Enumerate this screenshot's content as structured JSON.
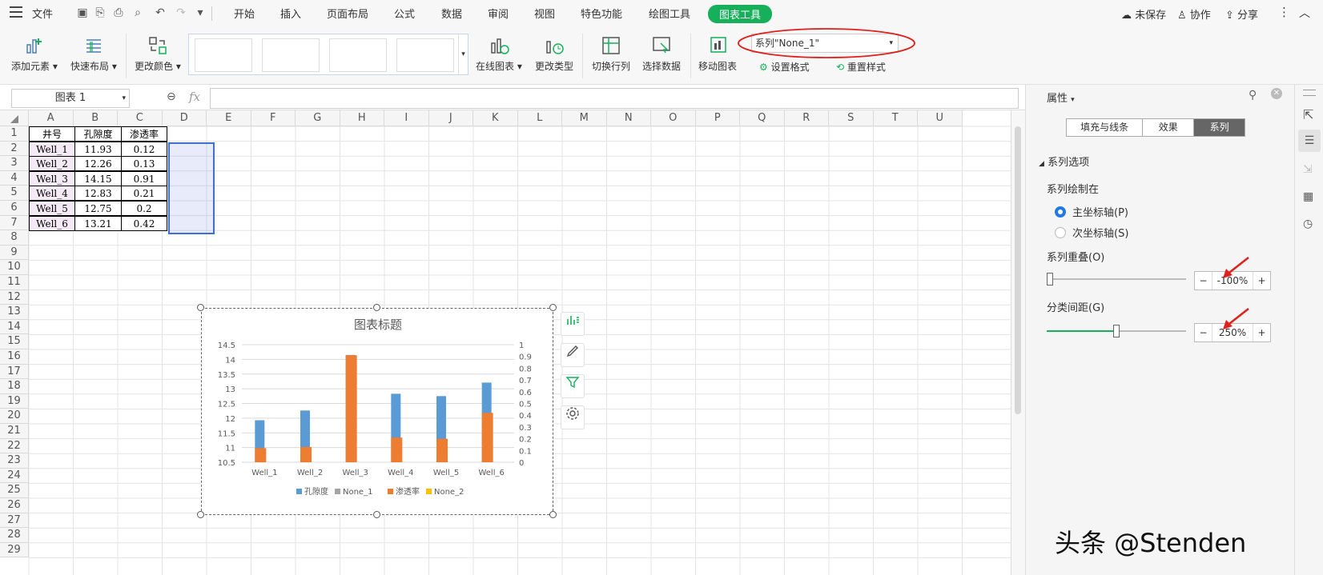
{
  "menubar": {
    "file": "文件",
    "tabs": [
      "开始",
      "插入",
      "页面布局",
      "公式",
      "数据",
      "审阅",
      "视图",
      "特色功能",
      "绘图工具",
      "图表工具"
    ],
    "right": {
      "unsaved": "未保存",
      "collab": "协作",
      "share": "分享"
    }
  },
  "ribbon": {
    "add_element": "添加元素",
    "quick_layout": "快速布局",
    "change_color": "更改颜色",
    "online_chart": "在线图表",
    "change_type": "更改类型",
    "switch_row_col": "切换行列",
    "select_data": "选择数据",
    "move_chart": "移动图表",
    "series_select": "系列\"None_1\"",
    "set_format": "设置格式",
    "reset_style": "重置样式"
  },
  "formula": {
    "name_box": "图表 1",
    "fx": "fx",
    "value": ""
  },
  "columns": [
    "A",
    "B",
    "C",
    "D",
    "E",
    "F",
    "G",
    "H",
    "I",
    "J",
    "K",
    "L",
    "M",
    "N",
    "O",
    "P",
    "Q",
    "R",
    "S",
    "T",
    "U"
  ],
  "rows": [
    "1",
    "2",
    "3",
    "4",
    "5",
    "6",
    "7",
    "8",
    "9",
    "10",
    "11",
    "12",
    "13",
    "14",
    "15",
    "16",
    "17",
    "18",
    "19",
    "20",
    "21",
    "22",
    "23",
    "24",
    "25",
    "26",
    "27",
    "28",
    "29"
  ],
  "table": {
    "headers": [
      "井号",
      "孔隙度",
      "渗透率"
    ],
    "rows": [
      [
        "Well_1",
        "11.93",
        "0.12"
      ],
      [
        "Well_2",
        "12.26",
        "0.13"
      ],
      [
        "Well_3",
        "14.15",
        "0.91"
      ],
      [
        "Well_4",
        "12.83",
        "0.21"
      ],
      [
        "Well_5",
        "12.75",
        "0.2"
      ],
      [
        "Well_6",
        "13.21",
        "0.42"
      ]
    ]
  },
  "chart_data": {
    "type": "bar",
    "title": "图表标题",
    "categories": [
      "Well_1",
      "Well_2",
      "Well_3",
      "Well_4",
      "Well_5",
      "Well_6"
    ],
    "series": [
      {
        "name": "孔隙度",
        "axis": "primary",
        "values": [
          11.93,
          12.26,
          14.15,
          12.83,
          12.75,
          13.21
        ],
        "color": "#5b9bd5"
      },
      {
        "name": "None_1",
        "axis": "primary",
        "values": [],
        "color": "#a5a5a5"
      },
      {
        "name": "渗透率",
        "axis": "secondary",
        "values": [
          0.12,
          0.13,
          0.91,
          0.21,
          0.2,
          0.42
        ],
        "color": "#ed7d31"
      },
      {
        "name": "None_2",
        "axis": "secondary",
        "values": [],
        "color": "#ffc000"
      }
    ],
    "y_ticks": [
      "14.5",
      "14",
      "13.5",
      "13",
      "12.5",
      "12",
      "11.5",
      "11",
      "10.5"
    ],
    "y2_ticks": [
      "1",
      "0.9",
      "0.8",
      "0.7",
      "0.6",
      "0.5",
      "0.4",
      "0.3",
      "0.2",
      "0.1",
      "0"
    ],
    "ylim": [
      10.5,
      14.5
    ],
    "y2lim": [
      0,
      1
    ],
    "legend": "bottom",
    "grid": true
  },
  "panel": {
    "title": "属性",
    "tabs": [
      "填充与线条",
      "效果",
      "系列"
    ],
    "active_tab": "系列",
    "section": "系列选项",
    "plot_on": "系列绘制在",
    "primary_axis": "主坐标轴(P)",
    "secondary_axis": "次坐标轴(S)",
    "overlap_label": "系列重叠(O)",
    "overlap_value": "-100%",
    "overlap_level": 0,
    "gap_label": "分类间距(G)",
    "gap_value": "250%",
    "gap_level": 0.5
  },
  "watermark": "头条 @Stenden"
}
